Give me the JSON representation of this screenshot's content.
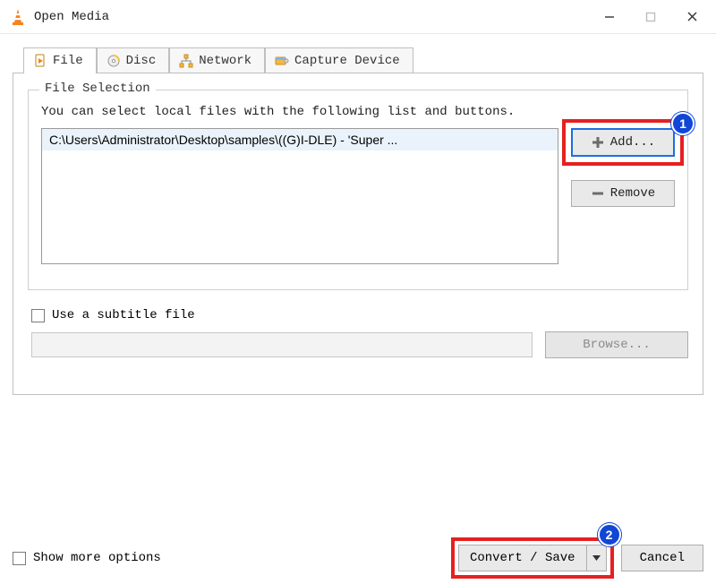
{
  "window": {
    "title": "Open Media"
  },
  "tabs": {
    "file": "File",
    "disc": "Disc",
    "network": "Network",
    "capture": "Capture Device"
  },
  "file_selection": {
    "legend": "File Selection",
    "hint": "You can select local files with the following list and buttons.",
    "files": [
      "C:\\Users\\Administrator\\Desktop\\samples\\((G)I-DLE) - 'Super ..."
    ],
    "add_label": "Add...",
    "remove_label": "Remove"
  },
  "subtitle": {
    "checkbox_label": "Use a subtitle file",
    "browse_label": "Browse..."
  },
  "footer": {
    "show_more_label": "Show more options",
    "convert_label": "Convert / Save",
    "cancel_label": "Cancel"
  },
  "annotations": {
    "badge1": "1",
    "badge2": "2"
  }
}
